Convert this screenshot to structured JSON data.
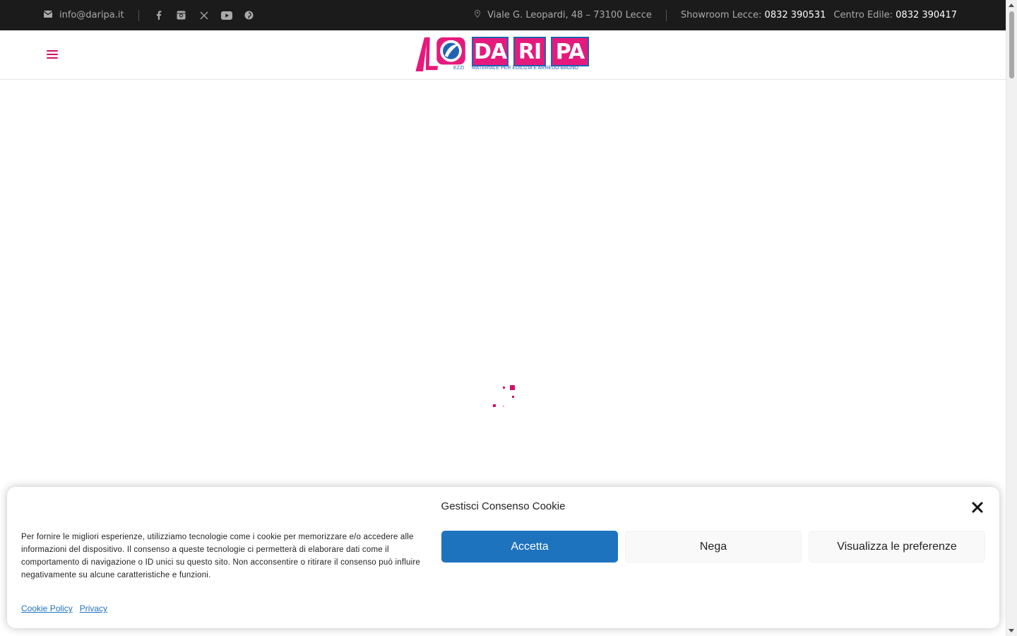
{
  "topbar": {
    "email": "info@daripa.it",
    "address": "Viale G. Leopardi, 48 – 73100 Lecce",
    "showroom_label": "Showroom Lecce:",
    "showroom_phone": "0832 390531",
    "edile_label": "Centro Edile:",
    "edile_phone": "0832 390417",
    "social_icons": [
      "facebook-icon",
      "instagram-icon",
      "x-icon",
      "youtube-icon",
      "pinterest-icon"
    ]
  },
  "logo": {
    "prefix": "AL",
    "ezzi": "EZZI",
    "letters": [
      "DA",
      "RI",
      "PA"
    ],
    "tagline": "MATERIALE PER EDILIZIA E ARREDO BAGNO"
  },
  "cookie": {
    "title": "Gestisci Consenso Cookie",
    "text": "Per fornire le migliori esperienze, utilizziamo tecnologie come i cookie per memorizzare e/o accedere alle informazioni del dispositivo. Il consenso a queste tecnologie ci permetterà di elaborare dati come il comportamento di navigazione o ID unici su questo sito. Non acconsentire o ritirare il consenso può influire negativamente su alcune caratteristiche e funzioni.",
    "accept_label": "Accetta",
    "deny_label": "Nega",
    "prefs_label": "Visualizza le preferenze",
    "cookie_policy_link": "Cookie Policy",
    "privacy_link": "Privacy"
  },
  "colors": {
    "accent": "#d1106c",
    "topbar_bg": "#1b1b1b",
    "accept_bg": "#1e73be",
    "link": "#1e73be"
  }
}
